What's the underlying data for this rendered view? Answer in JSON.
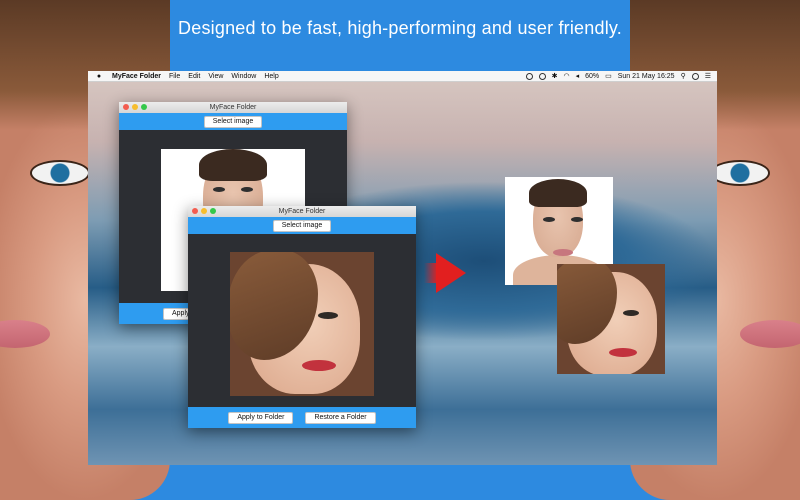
{
  "headline": "Designed to be fast, high-performing and user friendly.",
  "menubar": {
    "app_name": "MyFace Folder",
    "items": [
      "File",
      "Edit",
      "View",
      "Window",
      "Help"
    ],
    "battery": "60%",
    "datetime": "Sun 21 May  16:25"
  },
  "window_back": {
    "title": "MyFace Folder",
    "select_label": "Select image",
    "apply_label": "Apply to Folder"
  },
  "window_front": {
    "title": "MyFace Folder",
    "select_label": "Select image",
    "apply_label": "Apply to Folder",
    "restore_label": "Restore a Folder"
  },
  "colors": {
    "accent": "#2e9cf0",
    "arrow": "#e21f1f"
  }
}
